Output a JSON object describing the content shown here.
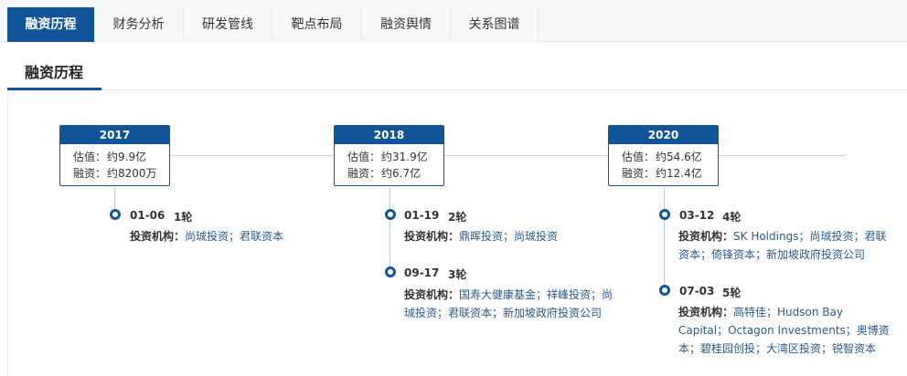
{
  "tabs": [
    {
      "label": "融资历程",
      "active": true
    },
    {
      "label": "财务分析",
      "active": false
    },
    {
      "label": "研发管线",
      "active": false
    },
    {
      "label": "靶点布局",
      "active": false
    },
    {
      "label": "融资舆情",
      "active": false
    },
    {
      "label": "关系图谱",
      "active": false
    }
  ],
  "section": {
    "title": "融资历程"
  },
  "labels": {
    "valuation": "估值：",
    "financing": "融资：",
    "investors": "投资机构："
  },
  "years": [
    {
      "year": "2017",
      "valuation": "约9.9亿",
      "financing": "约8200万"
    },
    {
      "year": "2018",
      "valuation": "约31.9亿",
      "financing": "约6.7亿"
    },
    {
      "year": "2020",
      "valuation": "约54.6亿",
      "financing": "约12.4亿"
    }
  ],
  "events": [
    {
      "date": "01-06",
      "round": "1轮",
      "investors": "尚珹投资；君联资本"
    },
    {
      "date": "01-19",
      "round": "2轮",
      "investors": "鼎晖投资；尚珹投资"
    },
    {
      "date": "09-17",
      "round": "3轮",
      "investors_line1": "国寿大健康基金；祥峰投资；尚",
      "investors_line2": "珹投资；君联资本；新加坡政府投资公司"
    },
    {
      "date": "03-12",
      "round": "4轮",
      "investors_line1": "SK Holdings；尚珹投资；君联",
      "investors_line2": "资本；倚锋资本；新加坡政府投资公司"
    },
    {
      "date": "07-03",
      "round": "5轮",
      "investors_line1": "高特佳；Hudson Bay",
      "investors_line2": "Capital；Octagon Investments；奥博资",
      "investors_line3": "本；碧桂园创投；大湾区投资；锐智资本"
    }
  ],
  "colors": {
    "accent": "#115497",
    "link": "#2a5a8c"
  }
}
